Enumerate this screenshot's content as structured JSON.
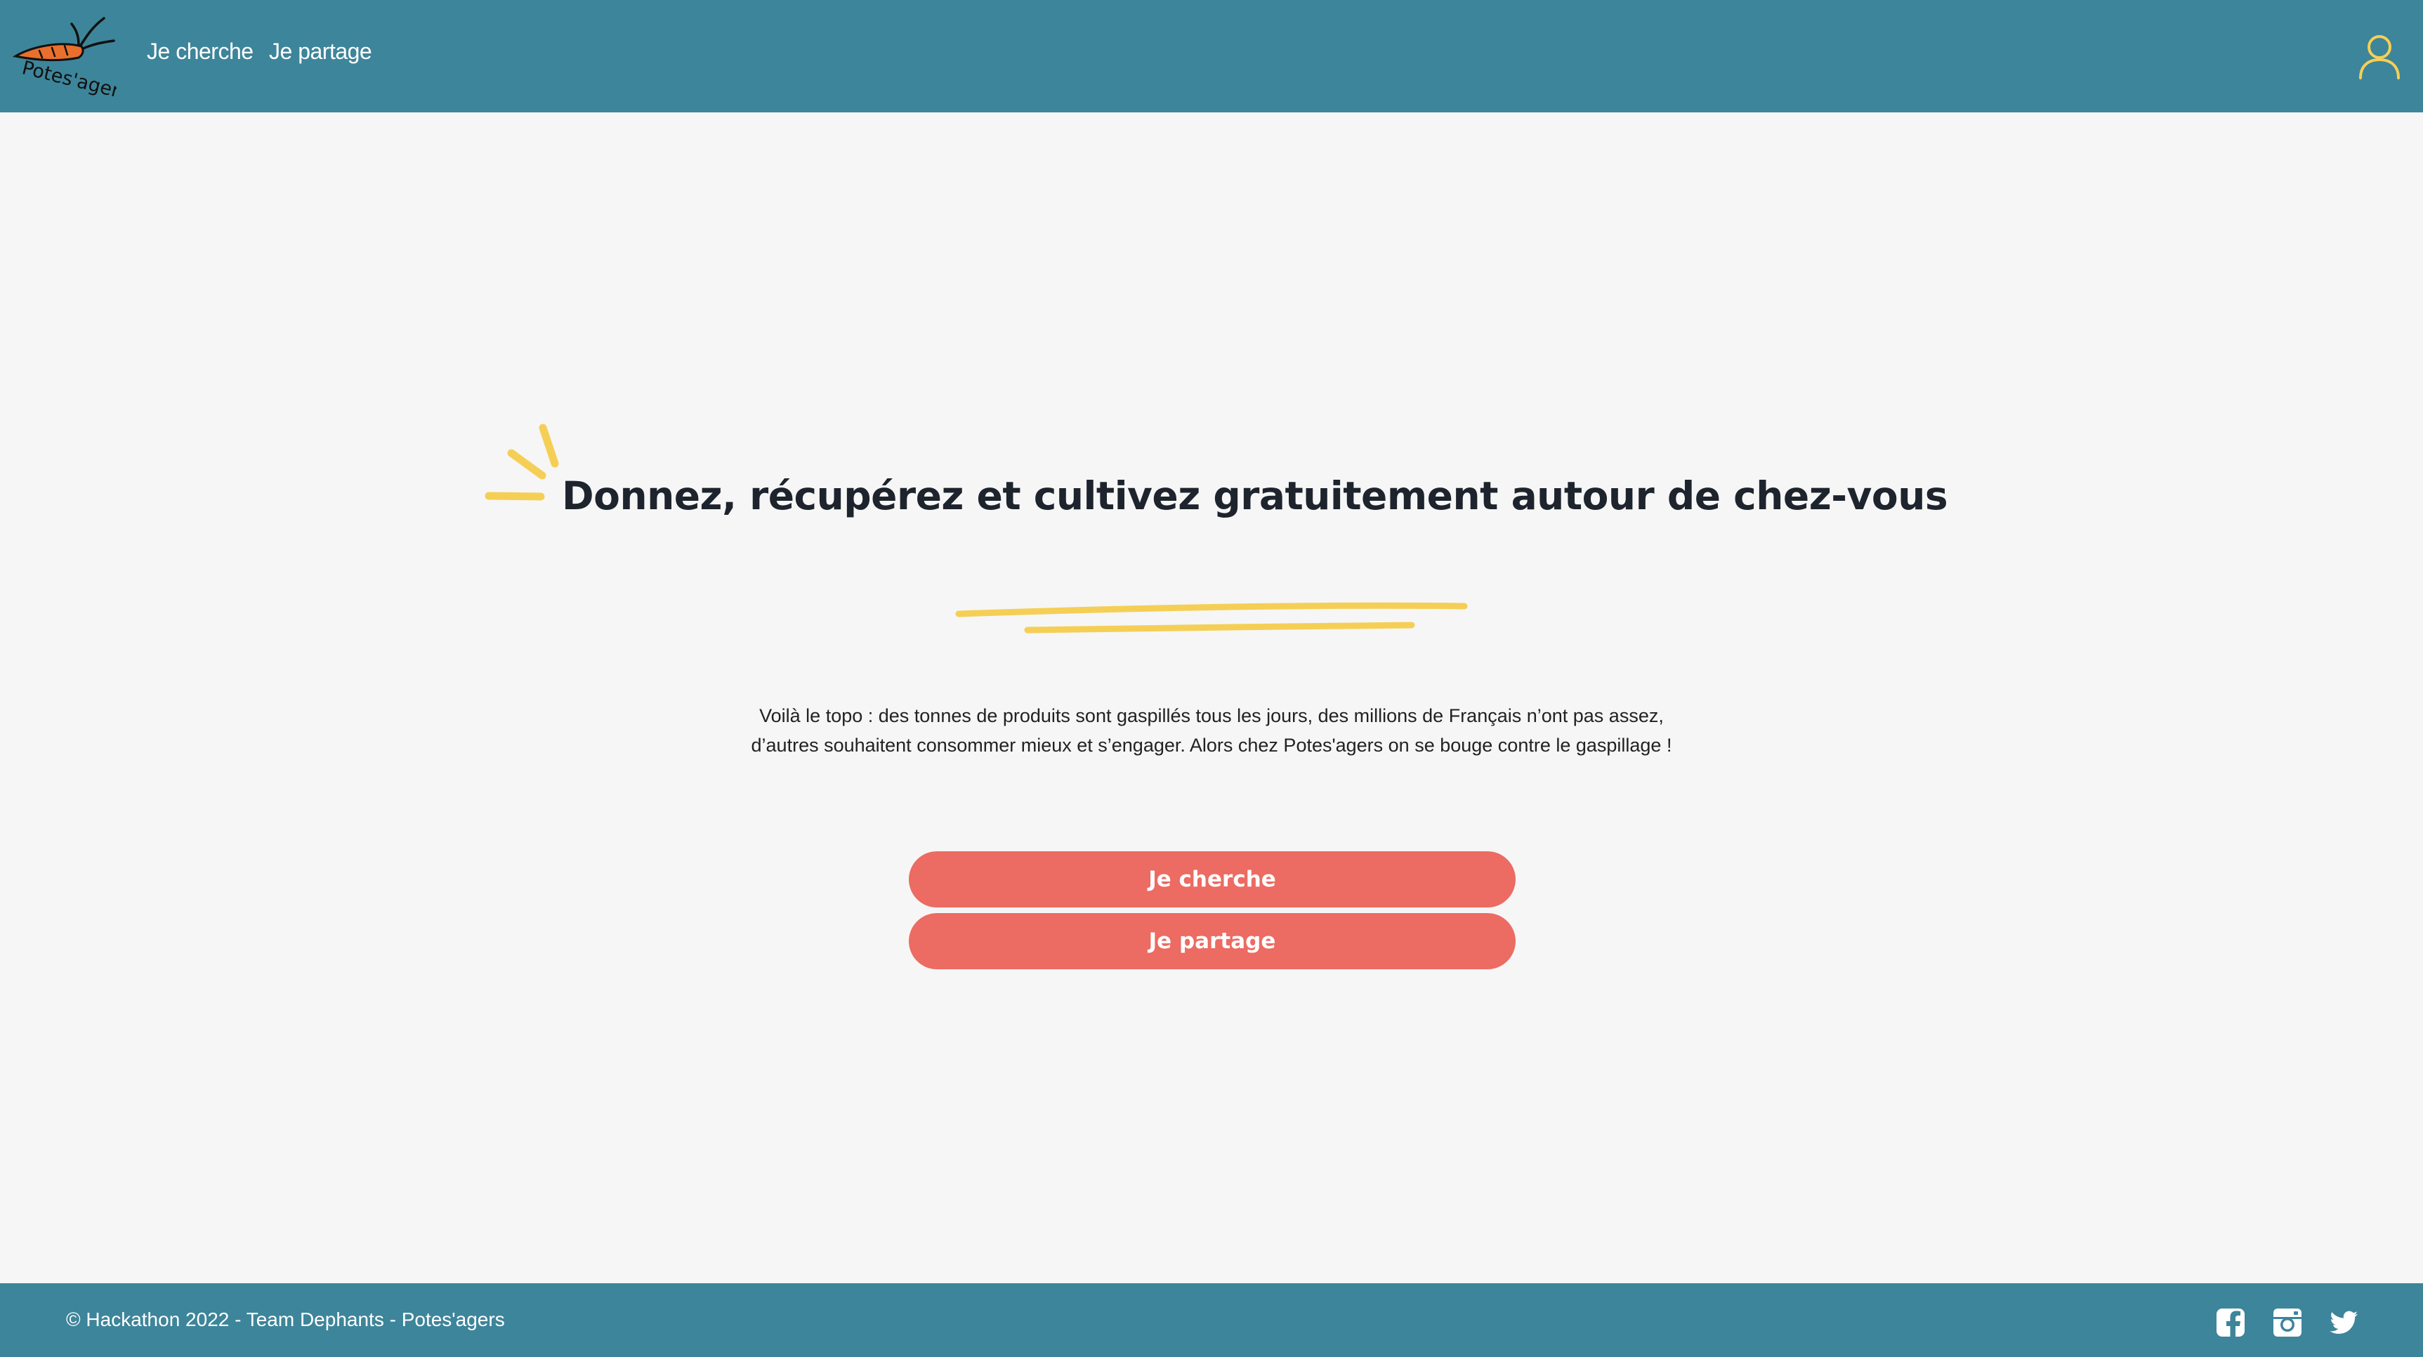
{
  "colors": {
    "header_bg": "#3d859a",
    "page_bg": "#f6f6f6",
    "accent_yellow": "#f5cf55",
    "cta_bg": "#ec6b62",
    "heading_text": "#1e242d"
  },
  "header": {
    "logo_text": "Potes'agers",
    "logo_icon": "carrot-icon",
    "nav": [
      {
        "label": "Je cherche"
      },
      {
        "label": "Je partage"
      }
    ],
    "account_icon": "user-icon"
  },
  "hero": {
    "title": "Donnez, récupérez et cultivez gratuitement autour de chez-vous",
    "intro_line1": "Voilà le topo : des tonnes de produits sont gaspillés tous les jours, des millions de Français n’ont pas assez,",
    "intro_line2": "d’autres souhaitent consommer mieux et s’engager. Alors chez Potes'agers on se bouge contre le gaspillage !",
    "buttons": {
      "search_label": "Je cherche",
      "share_label": "Je partage"
    }
  },
  "footer": {
    "copyright": "© Hackathon 2022 - Team Dephants - Potes'agers",
    "social": [
      "facebook-icon",
      "instagram-icon",
      "twitter-icon"
    ]
  }
}
